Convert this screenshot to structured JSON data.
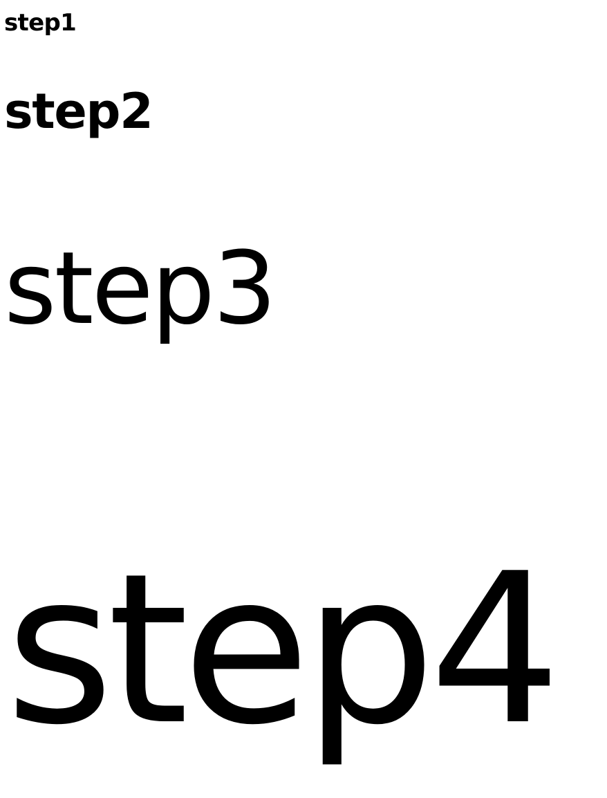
{
  "steps": [
    {
      "label": "step1"
    },
    {
      "label": "step2"
    },
    {
      "label": "step3"
    },
    {
      "label": "step4"
    }
  ]
}
